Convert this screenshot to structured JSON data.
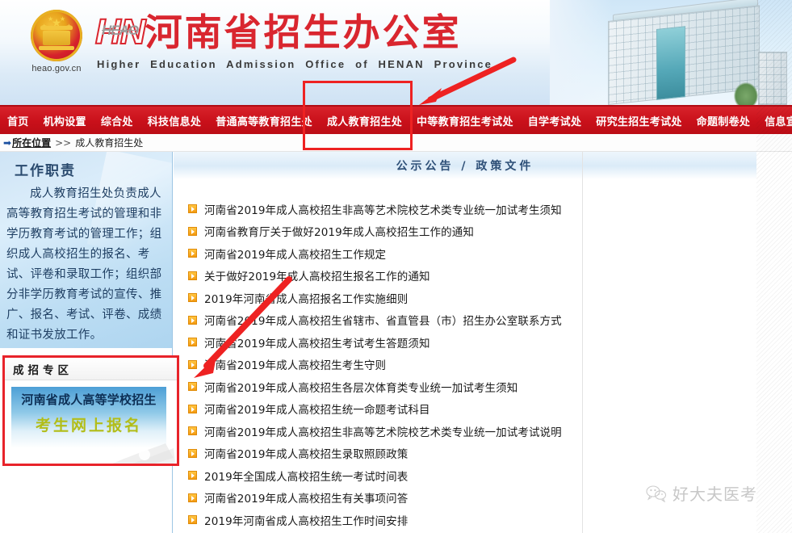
{
  "site": {
    "emblem_name": "china-national-emblem",
    "emblem_url": "heao.gov.cn",
    "logo_hn": "HN",
    "logo_heao": "HEAO",
    "title_cn": "河南省招生办公室",
    "title_en": "Higher Education Admission Office of HENAN Province",
    "accent_red": "#c9101a",
    "annotation_red": "#ee2222"
  },
  "nav": {
    "items": [
      {
        "label": "首页"
      },
      {
        "label": "机构设置"
      },
      {
        "label": "综合处"
      },
      {
        "label": "科技信息处"
      },
      {
        "label": "普通高等教育招生处"
      },
      {
        "label": "成人教育招生处"
      },
      {
        "label": "中等教育招生考试处"
      },
      {
        "label": "自学考试处"
      },
      {
        "label": "研究生招生考试处"
      },
      {
        "label": "命题制卷处"
      },
      {
        "label": "信息宣传中心"
      }
    ]
  },
  "breadcrumb": {
    "arrow_icon": "right-arrow-icon",
    "label": "所在位置",
    "separator": ">>",
    "current": "成人教育招生处"
  },
  "sidebar": {
    "duty": {
      "title": "工作职责",
      "text": "成人教育招生处负责成人高等教育招生考试的管理和非学历教育考试的管理工作；组织成人高校招生的报名、考试、评卷和录取工作；组织部分非学历教育考试的宣传、推广、报名、考试、评卷、成绩和证书发放工作。"
    },
    "zone": {
      "header": "成招专区",
      "banner_line1": "河南省成人高等学校招生",
      "banner_line2": "考生网上报名"
    }
  },
  "main": {
    "title": "公示公告 / 政策文件",
    "news": [
      {
        "bullet_icon": "orange-arrow-bullet-icon",
        "text": "河南省2019年成人高校招生非高等艺术院校艺术类专业统一加试考生须知"
      },
      {
        "bullet_icon": "orange-arrow-bullet-icon",
        "text": "河南省教育厅关于做好2019年成人高校招生工作的通知"
      },
      {
        "bullet_icon": "orange-arrow-bullet-icon",
        "text": "河南省2019年成人高校招生工作规定"
      },
      {
        "bullet_icon": "orange-arrow-bullet-icon",
        "text": "关于做好2019年成人高校招生报名工作的通知"
      },
      {
        "bullet_icon": "orange-arrow-bullet-icon",
        "text": "2019年河南省成人高招报名工作实施细则"
      },
      {
        "bullet_icon": "orange-arrow-bullet-icon",
        "text": "河南省2019年成人高校招生省辖市、省直管县（市）招生办公室联系方式"
      },
      {
        "bullet_icon": "orange-arrow-bullet-icon",
        "text": "河南省2019年成人高校招生考试考生答题须知"
      },
      {
        "bullet_icon": "orange-arrow-bullet-icon",
        "text": "河南省2019年成人高校招生考生守则"
      },
      {
        "bullet_icon": "orange-arrow-bullet-icon",
        "text": "河南省2019年成人高校招生各层次体育类专业统一加试考生须知"
      },
      {
        "bullet_icon": "orange-arrow-bullet-icon",
        "text": "河南省2019年成人高校招生统一命题考试科目"
      },
      {
        "bullet_icon": "orange-arrow-bullet-icon",
        "text": "河南省2019年成人高校招生非高等艺术院校艺术类专业统一加试考试说明"
      },
      {
        "bullet_icon": "orange-arrow-bullet-icon",
        "text": "河南省2019年成人高校招生录取照顾政策"
      },
      {
        "bullet_icon": "orange-arrow-bullet-icon",
        "text": "2019年全国成人高校招生统一考试时间表"
      },
      {
        "bullet_icon": "orange-arrow-bullet-icon",
        "text": "河南省2019年成人高校招生有关事项问答"
      },
      {
        "bullet_icon": "orange-arrow-bullet-icon",
        "text": "2019年河南省成人高校招生工作时间安排"
      }
    ]
  },
  "watermark": {
    "icon": "wechat-icon",
    "text": "好大夫医考"
  },
  "annotations": {
    "box_target": "成人教育招生处",
    "arrow_top_target": "成人教育招生处",
    "arrow_bottom_target": "成招专区"
  }
}
